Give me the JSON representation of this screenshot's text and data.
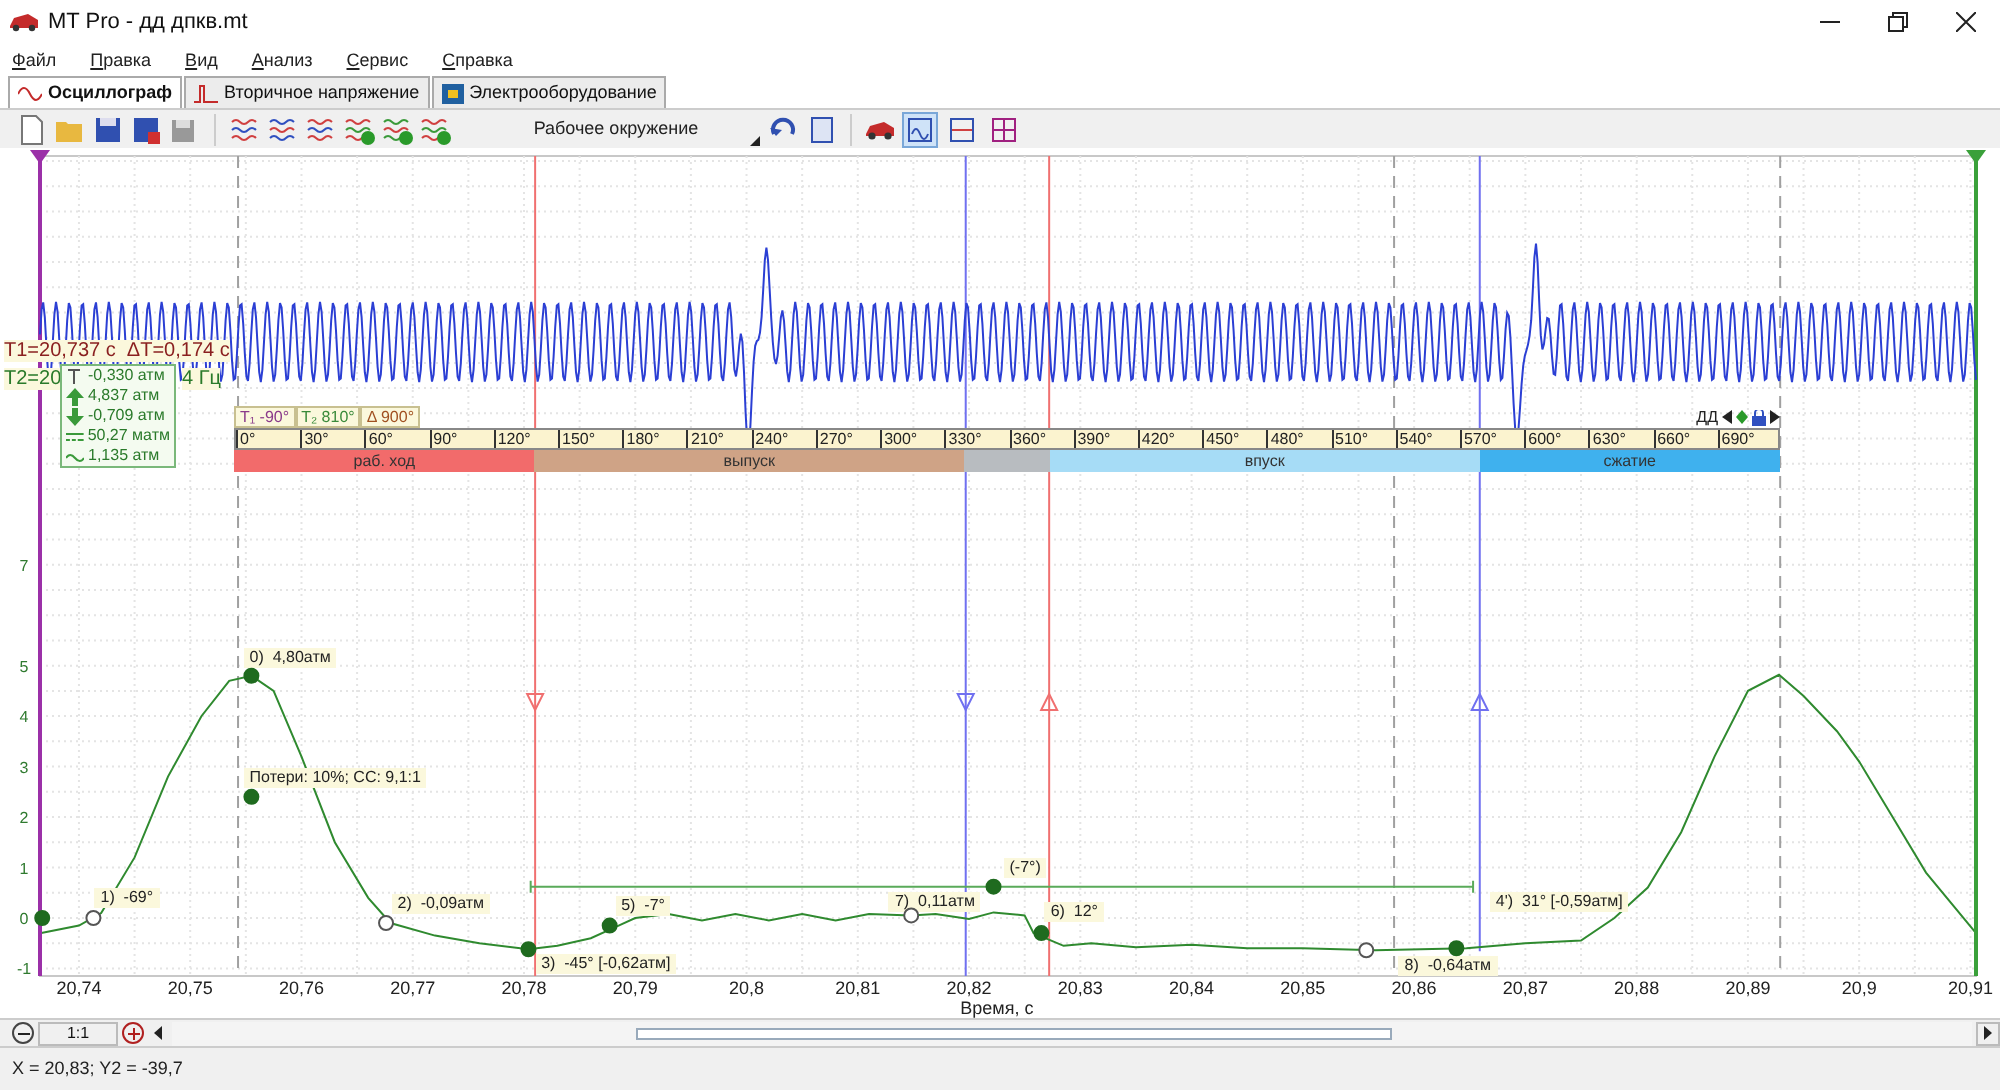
{
  "window": {
    "title": "MT Pro - дд дпкв.mt"
  },
  "menu": [
    "Файл",
    "Правка",
    "Вид",
    "Анализ",
    "Сервис",
    "Справка"
  ],
  "tabs": [
    {
      "label": "Осциллограф",
      "selected": true
    },
    {
      "label": "Вторичное напряжение",
      "selected": false
    },
    {
      "label": "Электрооборудование",
      "selected": false
    }
  ],
  "toolbar": {
    "dropdown": "Рабочее окружение",
    "view_buttons": [
      {
        "selected": true
      },
      {
        "selected": false
      },
      {
        "selected": false
      }
    ]
  },
  "cursor_info": {
    "line_1": "T1=20,737 с  ΔT=0,174 с",
    "line_2_start": "T2=20",
    "line_2_end": "4 Гц"
  },
  "cursor_readout": [
    {
      "kind": "t1",
      "text": "-0,330 атм"
    },
    {
      "kind": "max",
      "text": "4,837 атм"
    },
    {
      "kind": "min",
      "text": "-0,709 атм"
    },
    {
      "kind": "avg",
      "text": "50,27 матм"
    },
    {
      "kind": "rms",
      "text": "1,135 атм"
    }
  ],
  "degree_scale": {
    "tags": [
      {
        "symbol": "T₁",
        "text": "-90°",
        "color": "#8a3a8a"
      },
      {
        "symbol": "T₂",
        "text": "810°",
        "color": "#3a8a3a"
      },
      {
        "symbol": "Δ",
        "text": "900°",
        "color": "#a05020"
      }
    ],
    "mode": "ДД",
    "ticks": [
      "0°",
      "30°",
      "60°",
      "90°",
      "120°",
      "150°",
      "180°",
      "210°",
      "240°",
      "270°",
      "300°",
      "330°",
      "360°",
      "390°",
      "420°",
      "450°",
      "480°",
      "510°",
      "540°",
      "570°",
      "600°",
      "630°",
      "660°",
      "690°"
    ],
    "phases": [
      {
        "text": "раб. ход",
        "color": "#f26b6b"
      },
      {
        "text": "выпуск",
        "color": "#cfa386"
      },
      {
        "color": "#b8bcc0"
      },
      {
        "text": "впуск",
        "color": "#a6dcf6"
      },
      {
        "text": "сжатие",
        "color": "#3fb1ee"
      }
    ]
  },
  "marker_dots": [
    {
      "filled": true
    },
    {
      "filled": true
    },
    {
      "filled": true
    },
    {
      "filled": false
    },
    {
      "filled": false
    },
    {
      "filled": true
    },
    {
      "filled": true
    },
    {
      "filled": false
    },
    {
      "filled": true
    },
    {
      "filled": true
    },
    {
      "filled": false
    },
    {
      "filled": true
    }
  ],
  "chart_data": {
    "type": "line",
    "xlabel": "Время, с",
    "xlim": [
      20.7365,
      20.9105
    ],
    "ylim": [
      -1.15,
      15.1
    ],
    "grid": true,
    "xticks": [
      {
        "value": 20.74,
        "label": "20,74"
      },
      {
        "value": 20.75,
        "label": "20,75"
      },
      {
        "value": 20.76,
        "label": "20,76"
      },
      {
        "value": 20.77,
        "label": "20,77"
      },
      {
        "value": 20.78,
        "label": "20,78"
      },
      {
        "value": 20.79,
        "label": "20,79"
      },
      {
        "value": 20.8,
        "label": "20,8"
      },
      {
        "value": 20.81,
        "label": "20,81"
      },
      {
        "value": 20.82,
        "label": "20,82"
      },
      {
        "value": 20.83,
        "label": "20,83"
      },
      {
        "value": 20.84,
        "label": "20,84"
      },
      {
        "value": 20.85,
        "label": "20,85"
      },
      {
        "value": 20.86,
        "label": "20,86"
      },
      {
        "value": 20.87,
        "label": "20,87"
      },
      {
        "value": 20.88,
        "label": "20,88"
      },
      {
        "value": 20.89,
        "label": "20,89"
      },
      {
        "value": 20.9,
        "label": "20,9"
      },
      {
        "value": 20.91,
        "label": "20,91"
      }
    ],
    "yticks": [
      -1,
      0,
      1,
      2,
      3,
      4,
      5,
      7
    ],
    "x": [
      20.7365,
      20.74,
      20.742,
      20.745,
      20.748,
      20.751,
      20.7535,
      20.7555,
      20.7575,
      20.76,
      20.763,
      20.766,
      20.768,
      20.772,
      20.776,
      20.7804,
      20.783,
      20.786,
      20.7885,
      20.79,
      20.793,
      20.796,
      20.799,
      20.802,
      20.805,
      20.808,
      20.811,
      20.8148,
      20.817,
      20.82,
      20.8222,
      20.825,
      20.8258,
      20.8285,
      20.831,
      20.835,
      20.84,
      20.845,
      20.85,
      20.8565,
      20.8647,
      20.87,
      20.875,
      20.878,
      20.881,
      20.884,
      20.887,
      20.89,
      20.8928,
      20.895,
      20.898,
      20.9,
      20.903,
      20.906,
      20.9105
    ],
    "series": [
      {
        "color": "#2f8a2f",
        "values": [
          -0.3,
          -0.15,
          0.1,
          1.2,
          2.8,
          4.0,
          4.7,
          4.8,
          4.5,
          3.2,
          1.5,
          0.4,
          -0.1,
          -0.35,
          -0.5,
          -0.62,
          -0.55,
          -0.4,
          -0.15,
          0.0,
          0.08,
          -0.05,
          0.08,
          -0.05,
          0.08,
          -0.05,
          0.08,
          0.05,
          0.08,
          -0.02,
          0.11,
          0.05,
          -0.3,
          -0.55,
          -0.5,
          -0.58,
          -0.53,
          -0.6,
          -0.6,
          -0.64,
          -0.6,
          -0.5,
          -0.45,
          0.0,
          0.6,
          1.7,
          3.2,
          4.5,
          4.82,
          4.4,
          3.7,
          3.1,
          2.0,
          0.9,
          -0.3
        ]
      }
    ],
    "ref_lines": [
      {
        "axis": "x",
        "value": 20.7543,
        "color": "#a0a0a0"
      },
      {
        "axis": "x",
        "value": 20.8582,
        "color": "#a0a0a0"
      },
      {
        "axis": "x",
        "value": 20.8929,
        "color": "#a0a0a0"
      },
      {
        "axis": "x",
        "value": 20.781,
        "color": "#f07070"
      },
      {
        "axis": "x",
        "value": 20.8197,
        "color": "#7070f0"
      },
      {
        "axis": "x",
        "value": 20.8272,
        "color": "#f07070"
      },
      {
        "axis": "x",
        "value": 20.8659,
        "color": "#7070f0"
      }
    ],
    "annotations": [
      "0)  4,80атм",
      "Потери: 10%; СС: 9,1:1",
      "1)  -69°",
      "2)  -0,09атм",
      "3)  -45° [-0,62атм]",
      "5)  -7°",
      "7)  0,11атм",
      "(-7°)",
      "6)  12°",
      "8)  -0,64атм",
      "4')  31° [-0,59атм]"
    ]
  },
  "zoom": {
    "ratio": "1:1"
  },
  "status_bar": "X = 20,83; Y2 = -39,7"
}
